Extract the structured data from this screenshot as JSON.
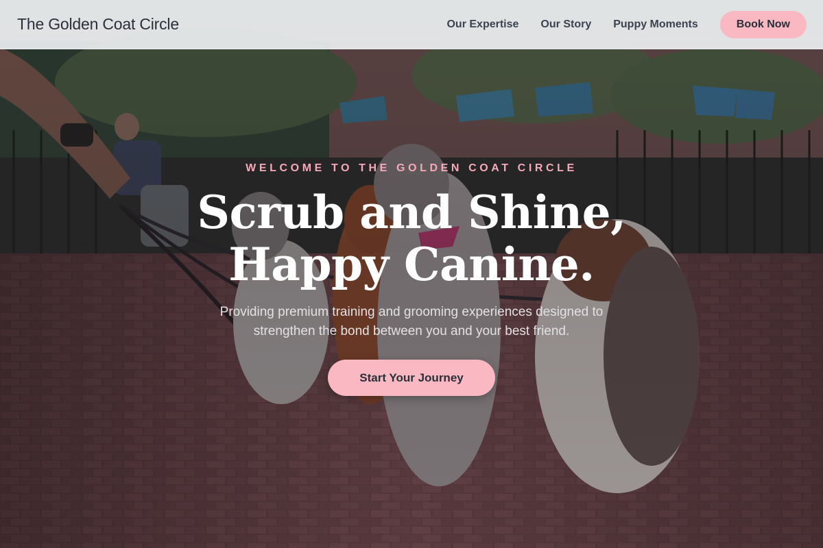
{
  "brand": {
    "name": "The Golden Coat Circle"
  },
  "nav": {
    "links": [
      "Our Expertise",
      "Our Story",
      "Puppy Moments"
    ],
    "cta_label": "Book Now"
  },
  "hero": {
    "eyebrow": "WELCOME TO THE GOLDEN COAT CIRCLE",
    "headline_line1": "Scrub and Shine,",
    "headline_line2": "Happy Canine.",
    "subtext_line1": "Providing premium training and grooming experiences designed to",
    "subtext_line2": "strengthen the bond between you and your best friend.",
    "cta_label": "Start Your Journey",
    "background_image": "dogs-on-leash-in-park-photo"
  },
  "colors": {
    "accent_pink": "#f9b8c2",
    "eyebrow_pink": "#f7a9b8",
    "nav_text": "#3b4250",
    "brand_text": "#2b2f3a"
  }
}
